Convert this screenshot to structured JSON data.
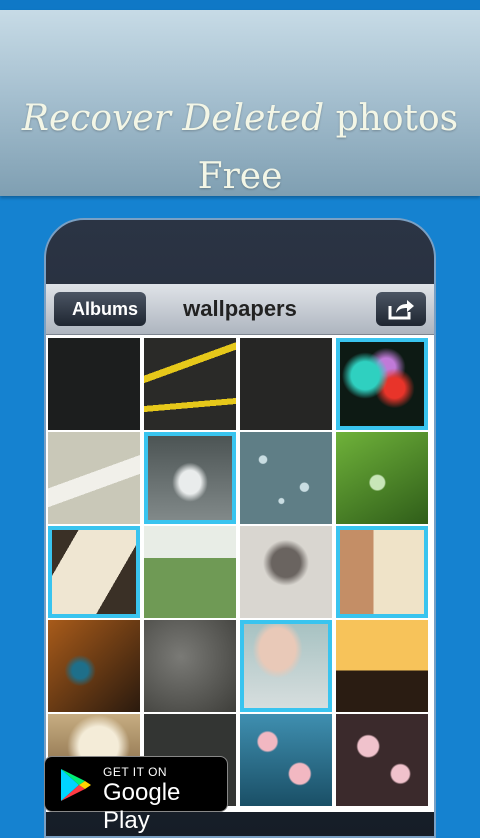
{
  "banner": {
    "title_italic": "Recover Deleted",
    "title_rest": " photos",
    "subtitle": "Free"
  },
  "navbar": {
    "back_label": "Albums",
    "title": "wallpapers",
    "share_icon": "share-icon"
  },
  "grid": {
    "tiles": [
      {
        "name": "dark-texture",
        "selected": false,
        "bg": "#1c1e1e"
      },
      {
        "name": "caution-tape",
        "selected": false,
        "bg": "#2a2a28"
      },
      {
        "name": "black-leather",
        "selected": false,
        "bg": "#262625"
      },
      {
        "name": "colored-smoke",
        "selected": true,
        "bg": "#0d1a14"
      },
      {
        "name": "life-ribbon",
        "selected": false,
        "bg": "#c9c8b8"
      },
      {
        "name": "trident",
        "selected": true,
        "bg": "#6a7070"
      },
      {
        "name": "water-drops",
        "selected": false,
        "bg": "#5f7e86"
      },
      {
        "name": "green-leaf-drops",
        "selected": false,
        "bg": "#3d7b22"
      },
      {
        "name": "playing-cards",
        "selected": true,
        "bg": "#3a3026"
      },
      {
        "name": "country-road",
        "selected": false,
        "bg": "#7e9c72"
      },
      {
        "name": "hugging-sketch",
        "selected": false,
        "bg": "#d9d6d0"
      },
      {
        "name": "couple-quote",
        "selected": true,
        "bg": "#8a6a52"
      },
      {
        "name": "peacock-buddha",
        "selected": false,
        "bg": "#5a3a1c"
      },
      {
        "name": "grey-rock",
        "selected": false,
        "bg": "#5c5c58"
      },
      {
        "name": "tattoo-girl",
        "selected": true,
        "bg": "#b9c6c4"
      },
      {
        "name": "sunset-silhouette",
        "selected": false,
        "bg": "#f1a238"
      },
      {
        "name": "daisy-closeup",
        "selected": false,
        "bg": "#b89a6a"
      },
      {
        "name": "dark-metal",
        "selected": false,
        "bg": "#333533"
      },
      {
        "name": "cherry-blossom-blue",
        "selected": false,
        "bg": "#2a6f8c"
      },
      {
        "name": "cherry-blossom-dark",
        "selected": false,
        "bg": "#3b2a2c"
      }
    ]
  },
  "store_badge": {
    "small_text": "GET IT ON",
    "big_text": "Google Play"
  },
  "colors": {
    "background": "#1582d0",
    "selection_border": "#39c4ef"
  }
}
